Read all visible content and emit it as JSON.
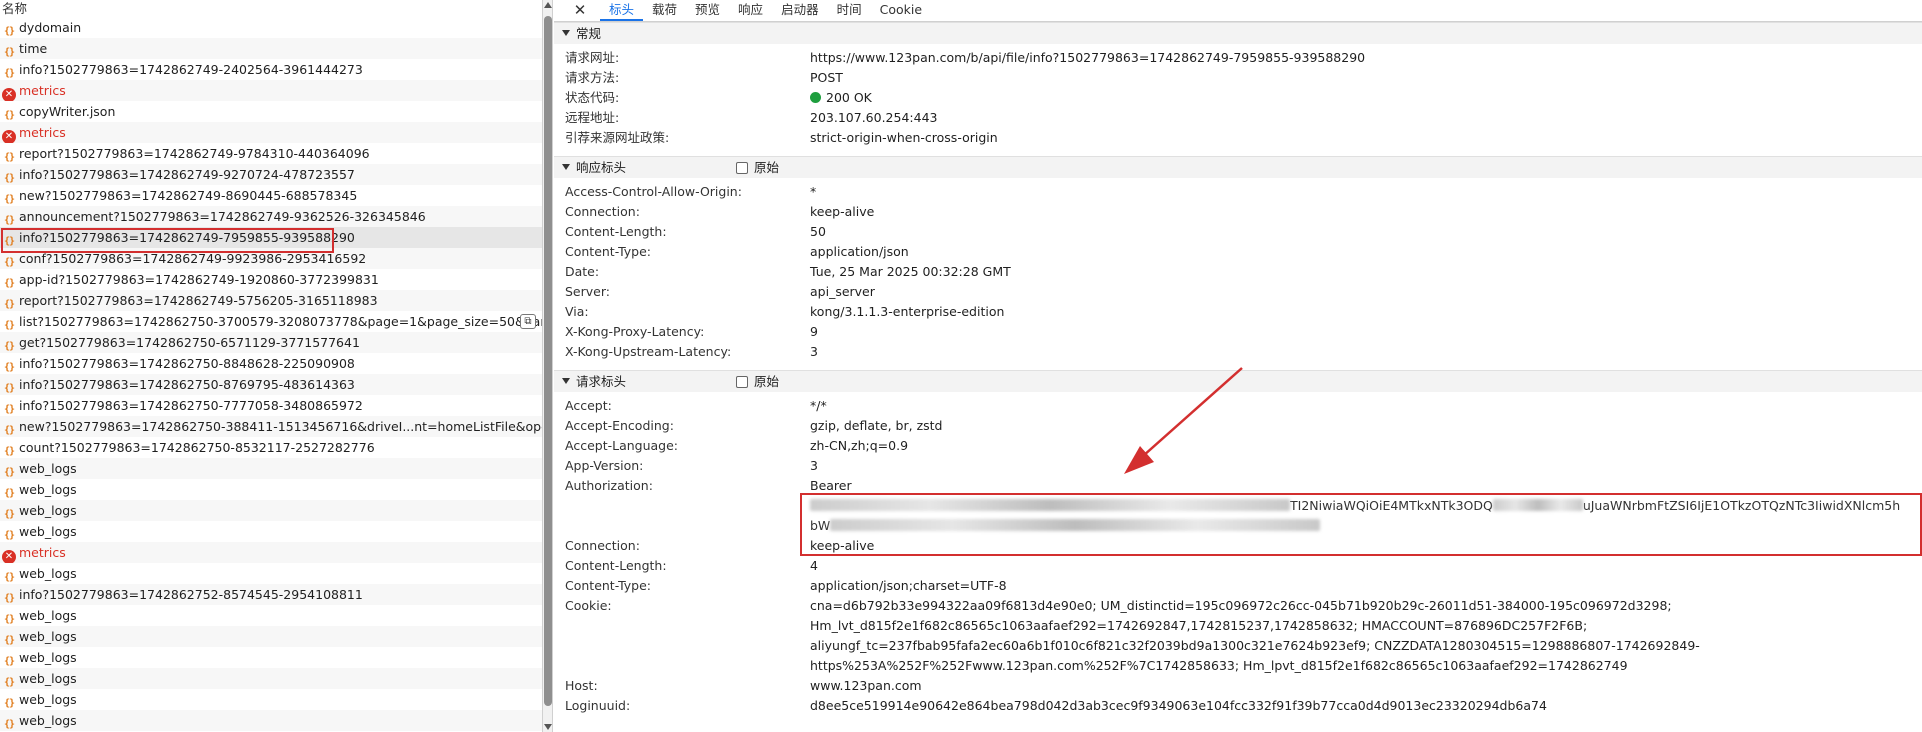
{
  "list": {
    "header": "名称",
    "items": [
      {
        "name": "dydomain",
        "type": "xhr"
      },
      {
        "name": "time",
        "type": "xhr"
      },
      {
        "name": "info?1502779863=1742862749-2402564-3961444273",
        "type": "xhr"
      },
      {
        "name": "metrics",
        "type": "error"
      },
      {
        "name": "copyWriter.json",
        "type": "xhr"
      },
      {
        "name": "metrics",
        "type": "error"
      },
      {
        "name": "report?1502779863=1742862749-9784310-440364096",
        "type": "xhr"
      },
      {
        "name": "info?1502779863=1742862749-9270724-478723557",
        "type": "xhr"
      },
      {
        "name": "new?1502779863=1742862749-8690445-688578345",
        "type": "xhr"
      },
      {
        "name": "announcement?1502779863=1742862749-9362526-326345846",
        "type": "xhr"
      },
      {
        "name": "info?1502779863=1742862749-7959855-939588290",
        "type": "xhr",
        "selected": true
      },
      {
        "name": "conf?1502779863=1742862749-9923986-2953416592",
        "type": "xhr"
      },
      {
        "name": "app-id?1502779863=1742862749-1920860-3772399831",
        "type": "xhr"
      },
      {
        "name": "report?1502779863=1742862749-5756205-3165118983",
        "type": "xhr"
      },
      {
        "name": "list?1502779863=1742862750-3700579-3208073778&page=1&page_size=50&parent...",
        "type": "xhr",
        "copy": true
      },
      {
        "name": "get?1502779863=1742862750-6571129-3771577641",
        "type": "xhr"
      },
      {
        "name": "info?1502779863=1742862750-8848628-225090908",
        "type": "xhr"
      },
      {
        "name": "info?1502779863=1742862750-8769795-483614363",
        "type": "xhr"
      },
      {
        "name": "info?1502779863=1742862750-7777058-3480865972",
        "type": "xhr"
      },
      {
        "name": "new?1502779863=1742862750-388411-1513456716&driveI...nt=homeListFile&operateT...",
        "type": "xhr"
      },
      {
        "name": "count?1502779863=1742862750-8532117-2527282776",
        "type": "xhr"
      },
      {
        "name": "web_logs",
        "type": "xhr"
      },
      {
        "name": "web_logs",
        "type": "xhr"
      },
      {
        "name": "web_logs",
        "type": "xhr"
      },
      {
        "name": "web_logs",
        "type": "xhr"
      },
      {
        "name": "metrics",
        "type": "error"
      },
      {
        "name": "web_logs",
        "type": "xhr"
      },
      {
        "name": "info?1502779863=1742862752-8574545-2954108811",
        "type": "xhr"
      },
      {
        "name": "web_logs",
        "type": "xhr"
      },
      {
        "name": "web_logs",
        "type": "xhr"
      },
      {
        "name": "web_logs",
        "type": "xhr"
      },
      {
        "name": "web_logs",
        "type": "xhr"
      },
      {
        "name": "web_logs",
        "type": "xhr"
      },
      {
        "name": "web_logs",
        "type": "xhr"
      }
    ]
  },
  "tabs": [
    "标头",
    "载荷",
    "预览",
    "响应",
    "启动器",
    "时间",
    "Cookie"
  ],
  "general": {
    "title": "常规",
    "rows": [
      {
        "k": "请求网址:",
        "v": "https://www.123pan.com/b/api/file/info?1502779863=1742862749-7959855-939588290"
      },
      {
        "k": "请求方法:",
        "v": "POST"
      },
      {
        "k": "状态代码:",
        "v": "200 OK",
        "status": true
      },
      {
        "k": "远程地址:",
        "v": "203.107.60.254:443"
      },
      {
        "k": "引荐来源网址政策:",
        "v": "strict-origin-when-cross-origin"
      }
    ]
  },
  "response_headers": {
    "title": "响应标头",
    "raw_label": "原始",
    "rows": [
      {
        "k": "Access-Control-Allow-Origin:",
        "v": "*"
      },
      {
        "k": "Connection:",
        "v": "keep-alive"
      },
      {
        "k": "Content-Length:",
        "v": "50"
      },
      {
        "k": "Content-Type:",
        "v": "application/json"
      },
      {
        "k": "Date:",
        "v": "Tue, 25 Mar 2025 00:32:28 GMT"
      },
      {
        "k": "Server:",
        "v": "api_server"
      },
      {
        "k": "Via:",
        "v": "kong/3.1.1.3-enterprise-edition"
      },
      {
        "k": "X-Kong-Proxy-Latency:",
        "v": "9"
      },
      {
        "k": "X-Kong-Upstream-Latency:",
        "v": "3"
      }
    ]
  },
  "request_headers": {
    "title": "请求标头",
    "raw_label": "原始",
    "rows_before": [
      {
        "k": "Accept:",
        "v": "*/*"
      },
      {
        "k": "Accept-Encoding:",
        "v": "gzip, deflate, br, zstd"
      },
      {
        "k": "Accept-Language:",
        "v": "zh-CN,zh;q=0.9"
      },
      {
        "k": "App-Version:",
        "v": "3"
      }
    ],
    "authorization": {
      "k": "Authorization:",
      "line1": "Bearer",
      "line2_visible": "TI2NiwiaWQiOiE4MTkxNTk3ODQ",
      "line2_visible_b": "uJuaWNrbmFtZSI6IjE1OTkzOTQzNTc3IiwidXNlcm5h",
      "line3_visible": "bW"
    },
    "rows_after": [
      {
        "k": "Connection:",
        "v": "keep-alive"
      },
      {
        "k": "Content-Length:",
        "v": "4"
      },
      {
        "k": "Content-Type:",
        "v": "application/json;charset=UTF-8"
      }
    ],
    "cookie": {
      "k": "Cookie:",
      "lines": [
        "cna=d6b792b33e994322aa09f6813d4e90e0; UM_distinctid=195c096972c26cc-045b71b920b29c-26011d51-384000-195c096972d3298;",
        "Hm_lvt_d815f2e1f682c86565c1063aafaef292=1742692847,1742815237,1742858632; HMACCOUNT=876896DC257F2F6B;",
        "aliyungf_tc=237fbab95fafa2ec60a6b1f010c6f821c32f2039bd9a1300c321e7624b923ef9; CNZZDATA1280304515=1298886807-1742692849-",
        "https%253A%252F%252Fwww.123pan.com%252F%7C1742858633; Hm_lpvt_d815f2e1f682c86565c1063aafaef292=1742862749"
      ]
    },
    "rows_tail": [
      {
        "k": "Host:",
        "v": "www.123pan.com"
      },
      {
        "k": "Loginuuid:",
        "v": "d8ee5ce519914e90642e864bea798d042d3ab3cec9f9349063e104fcc332f91f39b77cca0d4d9013ec23320294db6a74"
      }
    ]
  },
  "colors": {
    "accent": "#1a73e8",
    "error": "#d93025",
    "annotation": "#d32f2f",
    "status_ok": "#1e9e3e"
  }
}
